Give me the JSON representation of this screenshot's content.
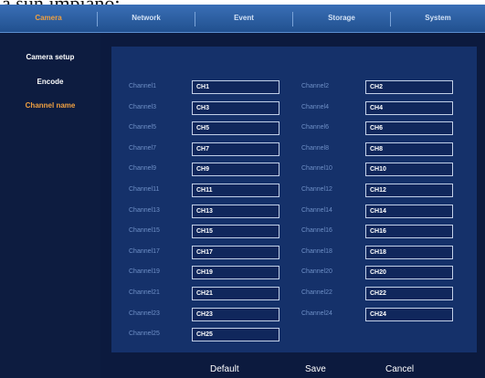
{
  "caption": "a sun impiano:",
  "nav": {
    "tabs": [
      "Camera",
      "Network",
      "Event",
      "Storage",
      "System"
    ],
    "active_tab": "Camera"
  },
  "sidebar": {
    "items": [
      "Camera setup",
      "Encode",
      "Channel name"
    ],
    "active_item": "Channel name"
  },
  "channels": [
    {
      "label": "Channel1",
      "value": "CH1"
    },
    {
      "label": "Channel2",
      "value": "CH2"
    },
    {
      "label": "Channel3",
      "value": "CH3"
    },
    {
      "label": "Channel4",
      "value": "CH4"
    },
    {
      "label": "Channel5",
      "value": "CH5"
    },
    {
      "label": "Channel6",
      "value": "CH6"
    },
    {
      "label": "Channel7",
      "value": "CH7"
    },
    {
      "label": "Channel8",
      "value": "CH8"
    },
    {
      "label": "Channel9",
      "value": "CH9"
    },
    {
      "label": "Channel10",
      "value": "CH10"
    },
    {
      "label": "Channel11",
      "value": "CH11"
    },
    {
      "label": "Channel12",
      "value": "CH12"
    },
    {
      "label": "Channel13",
      "value": "CH13"
    },
    {
      "label": "Channel14",
      "value": "CH14"
    },
    {
      "label": "Channel15",
      "value": "CH15"
    },
    {
      "label": "Channel16",
      "value": "CH16"
    },
    {
      "label": "Channel17",
      "value": "CH17"
    },
    {
      "label": "Channel18",
      "value": "CH18"
    },
    {
      "label": "Channel19",
      "value": "CH19"
    },
    {
      "label": "Channel20",
      "value": "CH20"
    },
    {
      "label": "Channel21",
      "value": "CH21"
    },
    {
      "label": "Channel22",
      "value": "CH22"
    },
    {
      "label": "Channel23",
      "value": "CH23"
    },
    {
      "label": "Channel24",
      "value": "CH24"
    },
    {
      "label": "Channel25",
      "value": "CH25"
    }
  ],
  "buttons": {
    "default_label": "Default",
    "save_label": "Save",
    "cancel_label": "Cancel"
  }
}
